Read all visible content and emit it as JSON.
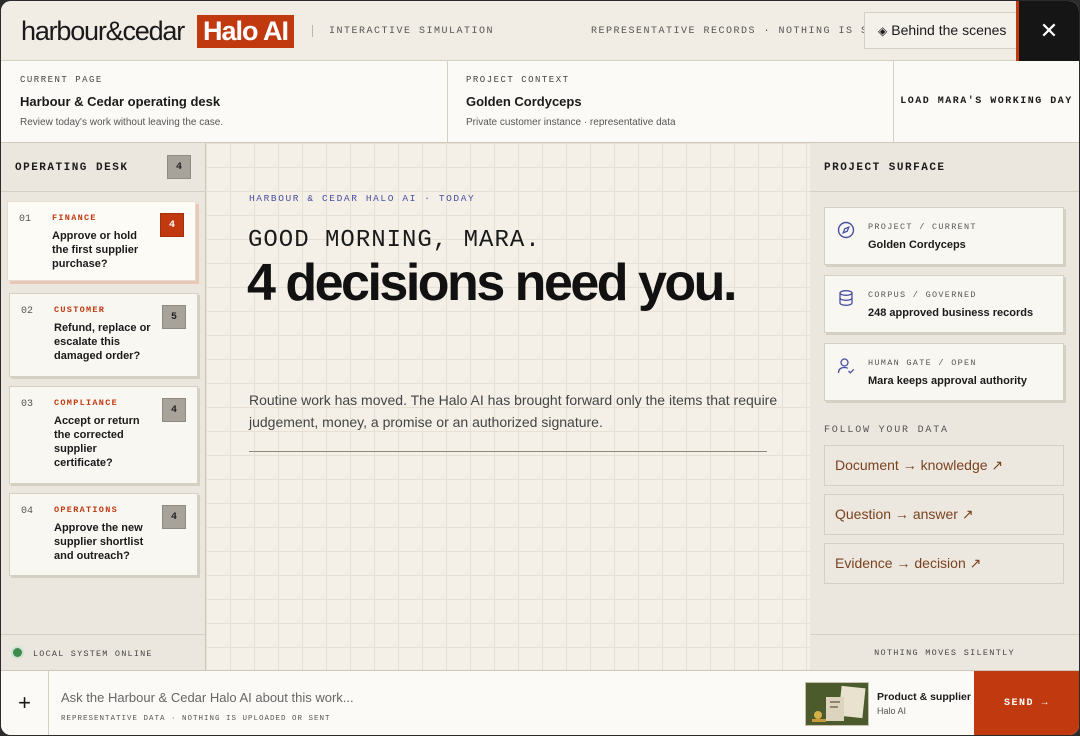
{
  "header": {
    "brand": "harbour&cedar",
    "product": "Halo AI",
    "mode_label": "INTERACTIVE SIMULATION",
    "records_label": "REPRESENTATIVE RECORDS · NOTHING IS SENT",
    "behind_button": "Behind the scenes",
    "close_icon": "close-icon",
    "accent_color": "#c0390f"
  },
  "context": {
    "current_page_label": "CURRENT PAGE",
    "current_page_title": "Harbour & Cedar operating desk",
    "current_page_sub": "Review today's work without leaving the case.",
    "project_label": "PROJECT CONTEXT",
    "project_title": "Golden Cordyceps",
    "project_sub": "Private customer instance · representative data",
    "load_button": "LOAD MARA'S WORKING DAY"
  },
  "desk": {
    "title": "OPERATING DESK",
    "count": "4",
    "tasks": [
      {
        "num": "01",
        "category": "FINANCE",
        "text": "Approve or hold the first supplier purchase?",
        "count": "4"
      },
      {
        "num": "02",
        "category": "CUSTOMER",
        "text": "Refund, replace or escalate this damaged order?",
        "count": "5"
      },
      {
        "num": "03",
        "category": "COMPLIANCE",
        "text": "Accept or return the corrected supplier certificate?",
        "count": "4"
      },
      {
        "num": "04",
        "category": "OPERATIONS",
        "text": "Approve the new supplier shortlist and outreach?",
        "count": "4"
      }
    ],
    "status": "LOCAL SYSTEM ONLINE"
  },
  "main": {
    "eyebrow": "HARBOUR & CEDAR HALO AI · TODAY",
    "greeting": "GOOD MORNING, MARA.",
    "headline": "4 decisions need you.",
    "lede": "Routine work has moved. The Halo AI has brought forward only the items that require judgement, money, a promise or an authorized signature."
  },
  "surface": {
    "title": "PROJECT SURFACE",
    "cards": [
      {
        "label": "PROJECT / CURRENT",
        "value": "Golden Cordyceps",
        "icon": "compass-icon"
      },
      {
        "label": "CORPUS / GOVERNED",
        "value": "248 approved business records",
        "icon": "database-icon"
      },
      {
        "label": "HUMAN GATE / OPEN",
        "value": "Mara keeps approval authority",
        "icon": "user-check-icon"
      }
    ],
    "follow_label": "FOLLOW YOUR DATA",
    "links": [
      {
        "label": "Document → knowledge ↗"
      },
      {
        "label": "Question → answer ↗"
      },
      {
        "label": "Evidence → decision ↗"
      }
    ],
    "footer": "NOTHING MOVES SILENTLY"
  },
  "composer": {
    "placeholder": "Ask the Harbour & Cedar Halo AI about this work...",
    "note": "REPRESENTATIVE DATA · NOTHING IS UPLOADED OR SENT",
    "context_name": "Product & supplier",
    "context_meta": "Halo AI",
    "send_label": "SEND →",
    "plus_label": "+"
  }
}
